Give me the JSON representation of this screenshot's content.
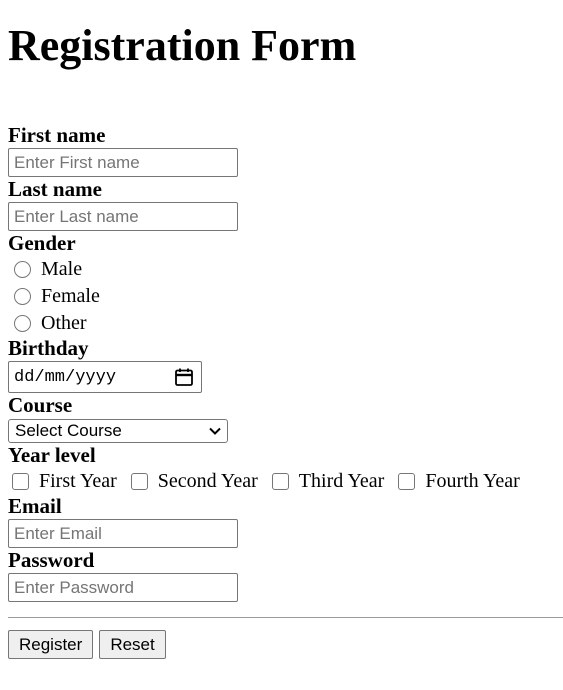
{
  "page": {
    "title": "Registration Form"
  },
  "form": {
    "first_name": {
      "label": "First name",
      "placeholder": "Enter First name",
      "value": ""
    },
    "last_name": {
      "label": "Last name",
      "placeholder": "Enter Last name",
      "value": ""
    },
    "gender": {
      "label": "Gender",
      "options": [
        "Male",
        "Female",
        "Other"
      ],
      "selected": null
    },
    "birthday": {
      "label": "Birthday",
      "placeholder": "dd/mm/yyyy",
      "icon": "calendar-icon"
    },
    "course": {
      "label": "Course",
      "selected": "Select Course",
      "icon": "chevron-down-icon"
    },
    "year_level": {
      "label": "Year level",
      "options": [
        "First Year",
        "Second Year",
        "Third Year",
        "Fourth Year"
      ],
      "checked": []
    },
    "email": {
      "label": "Email",
      "placeholder": "Enter Email",
      "value": ""
    },
    "password": {
      "label": "Password",
      "placeholder": "Enter Password",
      "value": ""
    }
  },
  "actions": {
    "register_label": "Register",
    "reset_label": "Reset"
  }
}
